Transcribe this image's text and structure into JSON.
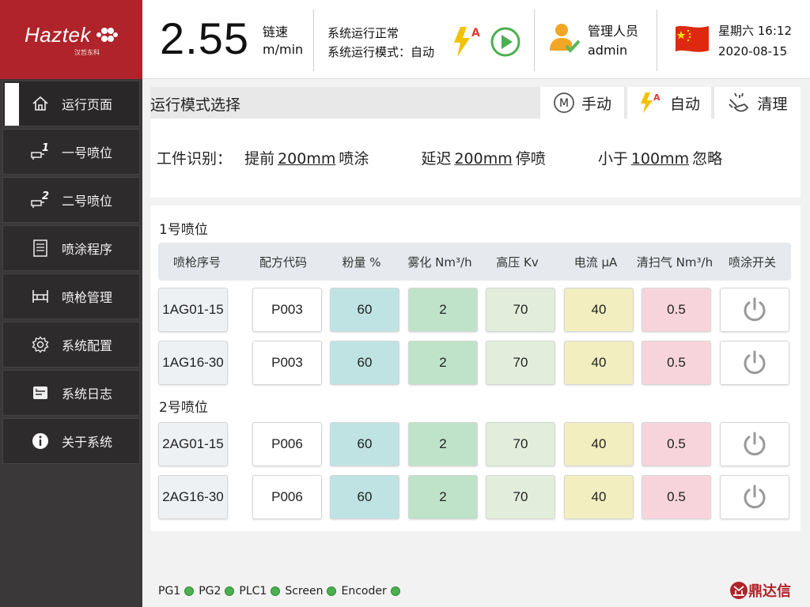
{
  "logo": {
    "brand": "Haztek",
    "sub": "汉哲东科"
  },
  "sidebar": {
    "items": [
      {
        "label": "运行页面",
        "icon": "home-icon"
      },
      {
        "label": "一号喷位",
        "icon": "spray-gun-1-icon"
      },
      {
        "label": "二号喷位",
        "icon": "spray-gun-2-icon"
      },
      {
        "label": "喷涂程序",
        "icon": "document-list-icon"
      },
      {
        "label": "喷枪管理",
        "icon": "gun-rack-icon"
      },
      {
        "label": "系统配置",
        "icon": "gear-icon"
      },
      {
        "label": "系统日志",
        "icon": "log-icon"
      },
      {
        "label": "关于系统",
        "icon": "info-icon"
      }
    ]
  },
  "header": {
    "speed": "2.55",
    "speed_label": "链速",
    "speed_unit": "m/min",
    "status_line1": "系统运行正常",
    "status_line2": "系统运行模式：自动",
    "user_role": "管理人员",
    "user_name": "admin",
    "weekday_time": "星期六 16:12",
    "date": "2020-08-15"
  },
  "mode": {
    "title": "运行模式选择",
    "tabs": [
      {
        "label": "手动",
        "icon": "manual-mode-icon"
      },
      {
        "label": "自动",
        "icon": "auto-mode-icon"
      },
      {
        "label": "清理",
        "icon": "clean-mode-icon"
      }
    ]
  },
  "ident": {
    "label": "工件识别：",
    "advance_pre": "提前",
    "advance_val": "200mm",
    "advance_post": "喷涂",
    "delay_pre": "延迟",
    "delay_val": "200mm",
    "delay_post": "停喷",
    "less_pre": "小于",
    "less_val": "100mm",
    "less_post": "忽略"
  },
  "table": {
    "headers": [
      "喷枪序号",
      "配方代码",
      "粉量 %",
      "雾化 Nm³/h",
      "高压 Kv",
      "电流 μA",
      "清扫气 Nm³/h",
      "喷涂开关"
    ],
    "groups": [
      {
        "title": "1号喷位",
        "rows": [
          [
            "1AG01-15",
            "P003",
            "60",
            "2",
            "70",
            "40",
            "0.5"
          ],
          [
            "1AG16-30",
            "P003",
            "60",
            "2",
            "70",
            "40",
            "0.5"
          ]
        ]
      },
      {
        "title": "2号喷位",
        "rows": [
          [
            "2AG01-15",
            "P006",
            "60",
            "2",
            "70",
            "40",
            "0.5"
          ],
          [
            "2AG16-30",
            "P006",
            "60",
            "2",
            "70",
            "40",
            "0.5"
          ]
        ]
      }
    ],
    "col_colors": [
      "#eef1f4",
      "#ffffff",
      "#bfe3e3",
      "#bfe3c9",
      "#e2eedb",
      "#f2eec0",
      "#f7d4dc",
      "#ffffff"
    ]
  },
  "footer": {
    "items": [
      "PG1",
      "PG2",
      "PLC1",
      "Screen",
      "Encoder"
    ]
  },
  "corp": {
    "name": "鼎达信"
  }
}
